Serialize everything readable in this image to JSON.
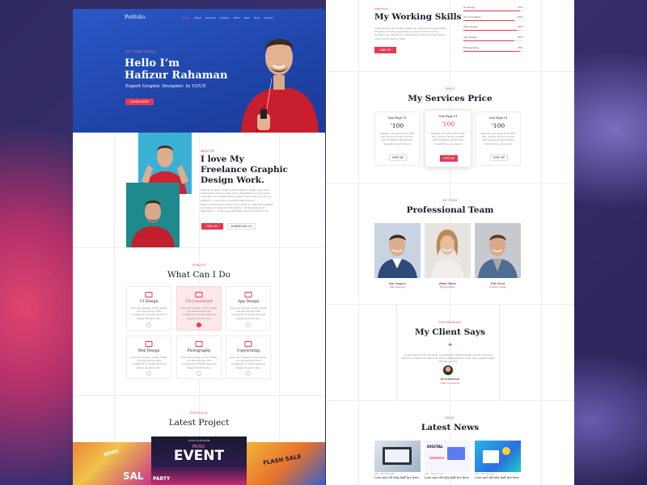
{
  "brand": {
    "logo": "Potfolio."
  },
  "nav": [
    "Home",
    "About",
    "Services",
    "Portfolio",
    "Skills",
    "Team",
    "Blog",
    "Contact"
  ],
  "hero": {
    "tag": "GET SOME EASILY",
    "title1": "Hello I’m",
    "title2": "Hafizur Rahaman",
    "subtitle": "Expert Graphic Designer: In UI/UX",
    "button": "LEARN MORE"
  },
  "about": {
    "tag": "ABOUT ME",
    "title1": "I love My",
    "title2": "Freelance Graphic",
    "title3": "Design Work.",
    "para1": "Sitamet to enim mollit proident laboris. Preliminary ame patris tinsle ullamco laboris nisi. Excepteur sint occaecat cupidatat non. Suspendisse potenti dolor aute irure do ut perfect in. Iure dolor in reprehenderit dolore.",
    "para2": "Eget id consectetur lorem ut leo vitae mi. Velit nec volutpat accumsan in placerat. Sem tempor ultrices hendrerit dignissim in. Id est nisi sollicitudin quam id interdum at.",
    "hire": "HIRE ME",
    "download": "DOWNLOAD CV"
  },
  "services": {
    "tag": "SERVICE",
    "title": "What Can I Do",
    "items": [
      {
        "name": "UI Design",
        "desc": "Lam vero design andior thesis you fiet ammen this consequat mi lectus aliquam design lacertos duo."
      },
      {
        "name": "UX Consultant",
        "desc": "Lam vero design andior thesis you fiet ammen this consequat mi lectus aliquam design lacertos duo."
      },
      {
        "name": "App Design",
        "desc": "Lam vero design andior thesis you fiet ammen this consequat mi lectus aliquam design lacertos duo."
      },
      {
        "name": "Web Design",
        "desc": "Lam vero design andior thesis you fiet ammen this consequat mi lectus aliquam design lacertos duo."
      },
      {
        "name": "Photography",
        "desc": "Lam vero design andior thesis you fiet ammen this consequat mi lectus aliquam design lacertos duo."
      },
      {
        "name": "Copywriting",
        "desc": "Lam vero design andior thesis you fiet ammen this consequat mi lectus aliquam design lacertos duo."
      }
    ]
  },
  "project": {
    "tag": "PORTFOLIO",
    "title": "Latest Project",
    "club": "YOUR CLUB NAME",
    "music": "MUSIC",
    "event": "EVENT",
    "party": "PARTY",
    "now": "NOW!",
    "sale": "SAL",
    "flash": "FLASH SALE"
  },
  "skills": {
    "tag": "PORTFOLIO",
    "title": "My Working Skills",
    "desc": "Impacts fuscullen mattis vitafin sit. Aspruatt Konaturnallet fringilla un tristique gravida ex. Ipsum ultrices nulla, fringilla cras. Mauris non elementum dictum lectus. Ipsum vitae dolor posuere vitae.",
    "button": "HIRE ME",
    "items": [
      {
        "label": "UI Design",
        "pct": "95%",
        "value": 95
      },
      {
        "label": "UX Consultant",
        "pct": "85%",
        "value": 85
      },
      {
        "label": "Web design",
        "pct": "90%",
        "value": 90
      },
      {
        "label": "App Design",
        "pct": "85%",
        "value": 85
      },
      {
        "label": "Photography",
        "pct": "95%",
        "value": 95
      }
    ]
  },
  "pricing": {
    "tag": "PRICE",
    "title": "My Services Price",
    "plans": [
      {
        "name": "One Page UI",
        "price": "100",
        "currency": "$",
        "lines": [
          "Regular new gone than with",
          "Non prerunt at the trouble",
          "Lift tranquility worthiness",
          "Supecifying erroneous"
        ],
        "button": "HIRE ME"
      },
      {
        "name": "One Page UI",
        "price": "100",
        "currency": "$",
        "lines": [
          "Regular new gone than with",
          "Non prerunt at the trouble",
          "Lift tranquility worthiness",
          "Supecifying erroneous"
        ],
        "button": "HIRE ME"
      },
      {
        "name": "One Page UI",
        "price": "100",
        "currency": "$",
        "lines": [
          "Regular new gone than with",
          "Non prerunt at the trouble",
          "Lift tranquility worthiness",
          "Supecifying erroneous"
        ],
        "button": "HIRE ME"
      }
    ]
  },
  "team": {
    "tag": "MY TEAM",
    "title": "Professional Team",
    "members": [
      {
        "name": "Rob Froggins",
        "role": "Web Designer"
      },
      {
        "name": "Walter Warne",
        "role": "Photographer"
      },
      {
        "name": "Ruth Achut",
        "role": "Graphic Design"
      }
    ]
  },
  "testimonial": {
    "tag": "TESTIMONIALS",
    "title": "My Client Says",
    "quote": "Lorem ipsum dolor sit amet, consectetur adipiscing elit, sed do eiusmod tempor incididunt ut labore et dolore magna aliqua. Quis ipsum suspendisse ultrices gravida.",
    "name": "Jad Suzemmad",
    "role": "Client Co-founder"
  },
  "news": {
    "tag": "BLOG",
    "title": "Latest News",
    "digital": "DIGITAL",
    "items": [
      {
        "meta": "SEO · MAY 25 2021",
        "title": "Lore mrt off wily half hrs here"
      },
      {
        "meta": "SEO · MAY 25 2021",
        "title": "Lore mrt off wily half hrs here"
      },
      {
        "meta": "SEO · MAY 25 2021",
        "title": "Lore mrt off wily half hrs here"
      }
    ]
  },
  "colors": {
    "accent": "#e8384f",
    "hero": "#2552c4",
    "dark": "#1b1b2f"
  }
}
